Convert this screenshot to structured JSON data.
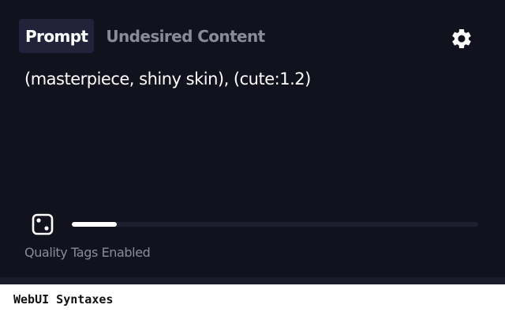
{
  "tabs": [
    {
      "label": "Prompt",
      "active": true
    },
    {
      "label": "Undesired Content",
      "active": false
    }
  ],
  "icons": {
    "settings": "gear-icon",
    "randomize": "dice-icon"
  },
  "prompt": {
    "text": "(masterpiece, shiny skin), (cute:1.2)"
  },
  "token_usage": {
    "fraction": 0.11
  },
  "quality_label": "Quality Tags Enabled",
  "caption": "WebUI Syntaxes",
  "colors": {
    "panel_background": "#12121f",
    "active_tab_background": "#22223a",
    "muted_text": "#8a8a9a",
    "primary_text": "#ffffff"
  }
}
